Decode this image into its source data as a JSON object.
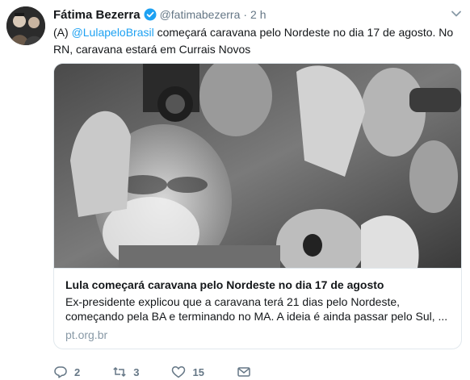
{
  "author": {
    "name": "Fátima Bezerra",
    "handle": "@fatimabezerra",
    "separator": "·",
    "time": "2 h"
  },
  "tweet": {
    "prefix": "(A) ",
    "mention": "@LulapeloBrasil",
    "suffix": " começará caravana pelo Nordeste no dia 17 de agosto. No RN, caravana estará em Currais Novos"
  },
  "card": {
    "title": "Lula começará caravana pelo Nordeste no dia 17 de agosto",
    "description": "Ex-presidente explicou que a caravana terá 21 dias pelo Nordeste, começando pela BA e terminando no MA. A ideia é ainda passar pelo Sul, ...",
    "domain": "pt.org.br"
  },
  "actions": {
    "replies": "2",
    "retweets": "3",
    "likes": "15"
  },
  "icons": {
    "verified": "verified-badge-icon",
    "chevron": "chevron-down-icon",
    "reply": "reply-icon",
    "retweet": "retweet-icon",
    "like": "heart-icon",
    "dm": "envelope-icon"
  },
  "colors": {
    "link": "#1da1f2",
    "muted": "#657786",
    "verified": "#1da1f2"
  }
}
